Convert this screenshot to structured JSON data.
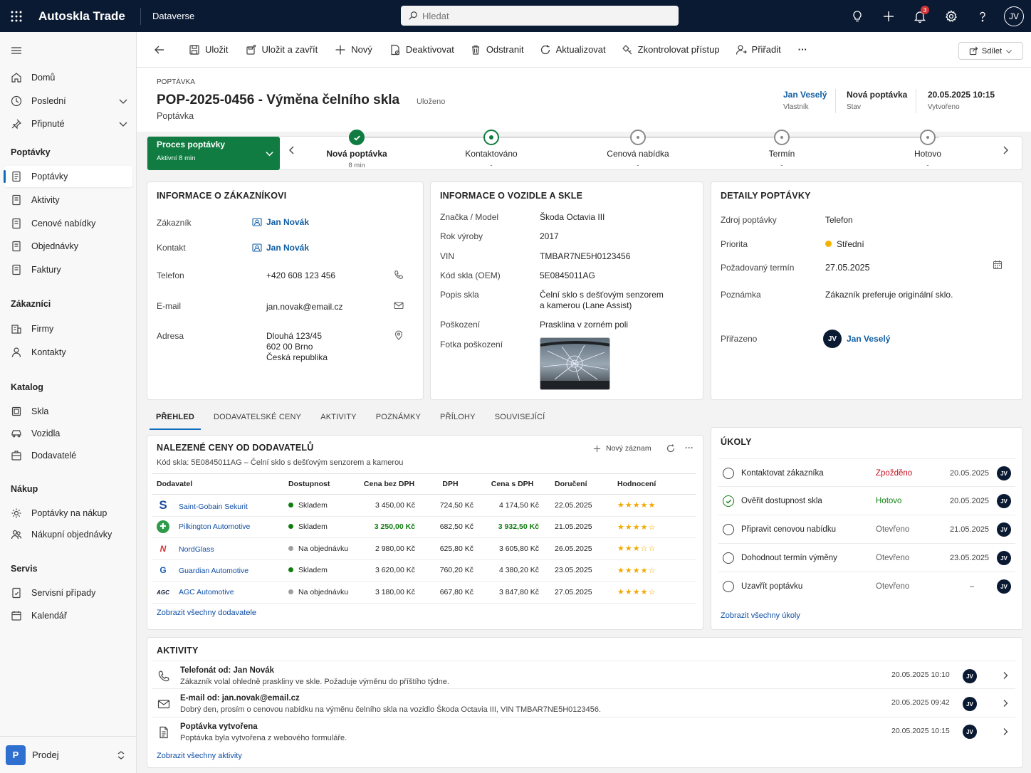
{
  "topbar": {
    "app_name": "Autoskla Trade",
    "environment": "Dataverse",
    "search_placeholder": "Hledat",
    "notifications_count": "3",
    "user_initials": "JV"
  },
  "sidebar": {
    "items_top": [
      {
        "label": "Domů",
        "icon": "home-icon"
      },
      {
        "label": "Poslední",
        "icon": "clock-icon"
      },
      {
        "label": "Připnuté",
        "icon": "pin-icon"
      }
    ],
    "groups": [
      {
        "title": "Poptávky",
        "items": [
          "Poptávky",
          "Aktivity",
          "Cenové nabídky",
          "Objednávky",
          "Faktury"
        ]
      },
      {
        "title": "Zákazníci",
        "items": [
          "Firmy",
          "Kontakty"
        ]
      },
      {
        "title": "Katalog",
        "items": [
          "Skla",
          "Vozidla",
          "Dodavatelé"
        ]
      },
      {
        "title": "Nákup",
        "items": [
          "Poptávky na nákup",
          "Nákupní objednávky"
        ]
      },
      {
        "title": "Servis",
        "items": [
          "Servisní případy",
          "Kalendář"
        ]
      }
    ],
    "area": {
      "badge": "P",
      "label": "Prodej"
    }
  },
  "commands": {
    "save": "Uložit",
    "save_close": "Uložit a zavřít",
    "new": "Nový",
    "deactivate": "Deaktivovat",
    "delete": "Odstranit",
    "refresh": "Aktualizovat",
    "check_access": "Zkontrolovat přístup",
    "assign": "Přiřadit",
    "more": "···",
    "share": "Sdílet"
  },
  "record": {
    "entity": "POPTÁVKA",
    "title": "POP-2025-0456 - Výměna čelního skla",
    "save_status": "Uloženo",
    "form_name": "Poptávka",
    "owner": {
      "value": "Jan Veselý",
      "label": "Vlastník"
    },
    "status": {
      "value": "Nová poptávka",
      "label": "Stav"
    },
    "created": {
      "value": "20.05.2025 10:15",
      "label": "Vytvořeno"
    }
  },
  "process": {
    "name": "Proces poptávky",
    "active_for": "Aktivní 8 min",
    "stages": [
      {
        "name": "Nová poptávka",
        "sub": "8 min",
        "state": "done"
      },
      {
        "name": "Kontaktováno",
        "sub": "-",
        "state": "current"
      },
      {
        "name": "Cenová nabídka",
        "sub": "-",
        "state": "pending"
      },
      {
        "name": "Termín",
        "sub": "-",
        "state": "pending"
      },
      {
        "name": "Hotovo",
        "sub": "-",
        "state": "pending"
      }
    ]
  },
  "customer": {
    "title": "INFORMACE O ZÁKAZNÍKOVI",
    "customer_label": "Zákazník",
    "customer": "Jan Novák",
    "contact_label": "Kontakt",
    "contact": "Jan Novák",
    "phone_label": "Telefon",
    "phone": "+420 608 123 456",
    "email_label": "E-mail",
    "email": "jan.novak@email.cz",
    "address_label": "Adresa",
    "address1": "Dlouhá 123/45",
    "address2": "602 00 Brno",
    "address3": "Česká republika"
  },
  "vehicle": {
    "title": "INFORMACE O VOZIDLE A SKLE",
    "make_label": "Značka / Model",
    "make": "Škoda Octavia III",
    "year_label": "Rok výroby",
    "year": "2017",
    "vin_label": "VIN",
    "vin": "TMBAR7NE5H0123456",
    "oem_label": "Kód skla (OEM)",
    "oem": "5E0845011AG",
    "desc_label": "Popis skla",
    "desc1": "Čelní sklo s dešťovým senzorem",
    "desc2": "a kamerou (Lane Assist)",
    "damage_label": "Poškození",
    "damage": "Prasklina v zorném poli",
    "photo_label": "Fotka poškození"
  },
  "details": {
    "title": "DETAILY POPTÁVKY",
    "source_label": "Zdroj poptávky",
    "source": "Telefon",
    "priority_label": "Priorita",
    "priority": "Střední",
    "due_label": "Požadovaný termín",
    "due": "27.05.2025",
    "note_label": "Poznámka",
    "note": "Zákazník preferuje originální sklo.",
    "assigned_label": "Přiřazeno",
    "assigned": "Jan Veselý",
    "assigned_initials": "JV"
  },
  "tabs": [
    "PŘEHLED",
    "DODAVATELSKÉ CENY",
    "AKTIVITY",
    "POZNÁMKY",
    "PŘÍLOHY",
    "SOUVISEJÍCÍ"
  ],
  "suppliers": {
    "title": "NALEZENÉ CENY OD DODAVATELŮ",
    "new_record": "Nový záznam",
    "subtitle": "Kód skla: 5E0845011AG – Čelní sklo s dešťovým senzorem a kamerou",
    "columns": [
      "Dodavatel",
      "Dostupnost",
      "Cena bez DPH",
      "DPH",
      "Cena s DPH",
      "Doručení",
      "Hodnocení"
    ],
    "rows": [
      {
        "logo": "S",
        "name": "Saint-Gobain Sekurit",
        "avail": "Skladem",
        "avail_color": "#107c10",
        "net": "3 450,00 Kč",
        "vat": "724,50 Kč",
        "gross": "4 174,50 Kč",
        "delivery": "22.05.2025",
        "rating": "★★★★★",
        "best": false
      },
      {
        "logo": "✚",
        "name": "Pilkington Automotive",
        "avail": "Skladem",
        "avail_color": "#107c10",
        "net": "3 250,00 Kč",
        "vat": "682,50 Kč",
        "gross": "3 932,50 Kč",
        "delivery": "21.05.2025",
        "rating": "★★★★☆",
        "best": true
      },
      {
        "logo": "N",
        "name": "NordGlass",
        "avail": "Na objednávku",
        "avail_color": "#9e9e9e",
        "net": "2 980,00 Kč",
        "vat": "625,80 Kč",
        "gross": "3 605,80 Kč",
        "delivery": "26.05.2025",
        "rating": "★★★☆☆",
        "best": false
      },
      {
        "logo": "G",
        "name": "Guardian Automotive",
        "avail": "Skladem",
        "avail_color": "#107c10",
        "net": "3 620,00 Kč",
        "vat": "760,20 Kč",
        "gross": "4 380,20 Kč",
        "delivery": "23.05.2025",
        "rating": "★★★★☆",
        "best": false
      },
      {
        "logo": "AGC",
        "name": "AGC Automotive",
        "avail": "Na objednávku",
        "avail_color": "#9e9e9e",
        "net": "3 180,00 Kč",
        "vat": "667,80 Kč",
        "gross": "3 847,80 Kč",
        "delivery": "27.05.2025",
        "rating": "★★★★☆",
        "best": false
      }
    ],
    "show_all": "Zobrazit všechny dodavatele"
  },
  "tasks": {
    "title": "ÚKOLY",
    "items": [
      {
        "name": "Kontaktovat zákazníka",
        "status": "Zpožděno",
        "status_color": "#c50f1f",
        "date": "20.05.2025",
        "done": false,
        "initials": "JV"
      },
      {
        "name": "Ověřit dostupnost skla",
        "status": "Hotovo",
        "status_color": "#107c10",
        "date": "20.05.2025",
        "done": true,
        "initials": "JV"
      },
      {
        "name": "Připravit cenovou nabídku",
        "status": "Otevřeno",
        "status_color": "#616161",
        "date": "21.05.2025",
        "done": false,
        "initials": "JV"
      },
      {
        "name": "Dohodnout termín výměny",
        "status": "Otevřeno",
        "status_color": "#616161",
        "date": "23.05.2025",
        "done": false,
        "initials": "JV"
      },
      {
        "name": "Uzavřít poptávku",
        "status": "Otevřeno",
        "status_color": "#616161",
        "date": "–",
        "done": false,
        "initials": "JV"
      }
    ],
    "show_all": "Zobrazit všechny úkoly"
  },
  "activities": {
    "title": "AKTIVITY",
    "items": [
      {
        "icon": "phone-icon",
        "title": "Telefonát od: Jan Novák",
        "desc": "Zákazník volal ohledně praskliny ve skle. Požaduje výměnu do příštího týdne.",
        "date": "20.05.2025 10:10",
        "initials": "JV"
      },
      {
        "icon": "mail-icon",
        "title": "E-mail od: jan.novak@email.cz",
        "desc": "Dobrý den, prosím o cenovou nabídku na výměnu čelního skla na vozidlo Škoda Octavia III, VIN TMBAR7NE5H0123456.",
        "date": "20.05.2025 09:42",
        "initials": "JV"
      },
      {
        "icon": "document-icon",
        "title": "Poptávka vytvořena",
        "desc": "Poptávka byla vytvořena z webového formuláře.",
        "date": "20.05.2025 10:15",
        "initials": "JV"
      }
    ],
    "show_all": "Zobrazit všechny aktivity"
  }
}
